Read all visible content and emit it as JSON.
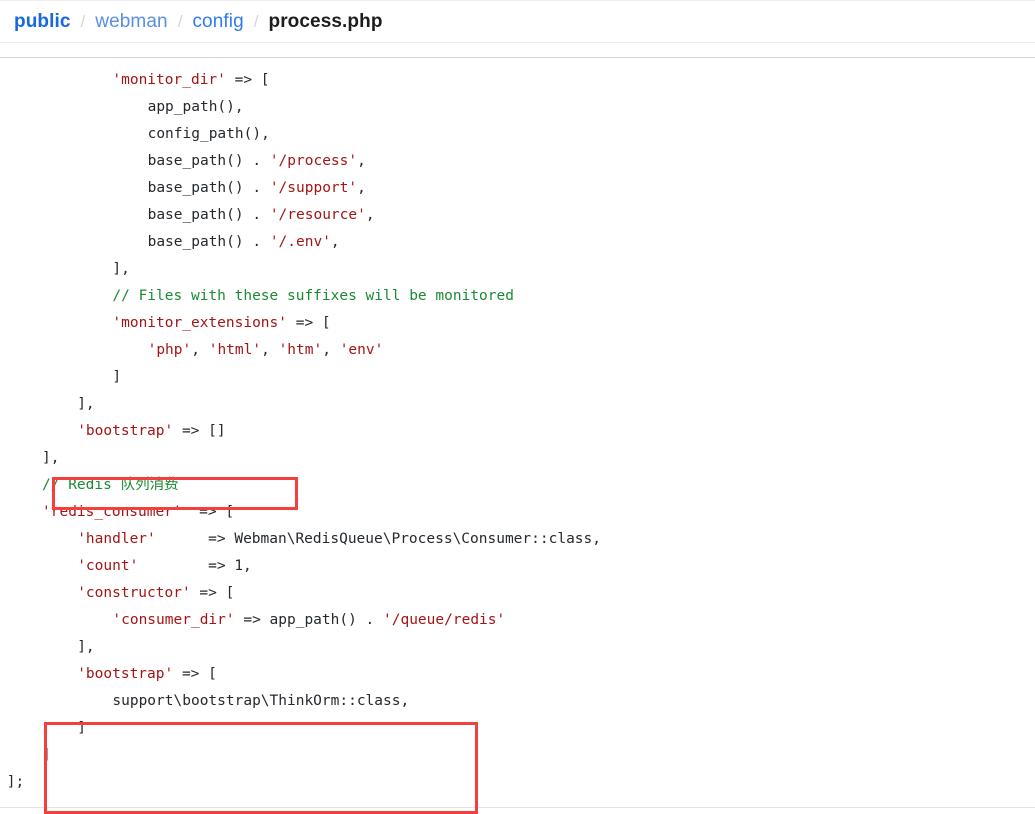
{
  "breadcrumb": {
    "separator": "/",
    "items": [
      {
        "label": "public",
        "kind": "root-link"
      },
      {
        "label": "webman",
        "kind": "link"
      },
      {
        "label": "config",
        "kind": "link"
      },
      {
        "label": "process.php",
        "kind": "current-file"
      }
    ]
  },
  "editor": {
    "language": "php",
    "file_name": "process.php",
    "colors": {
      "string": "#a31515",
      "comment": "#1a8a33",
      "plain": "#24292e",
      "annotation": "#f4403c",
      "breadcrumb_link": "#2f7ced",
      "breadcrumb_current": "#1d1d1d"
    },
    "lines": [
      {
        "indent": 8,
        "parts": [
          {
            "t": "str",
            "v": "'monitor_dir'"
          },
          {
            "t": "pla",
            "v": " => ["
          }
        ]
      },
      {
        "indent": 12,
        "parts": [
          {
            "t": "pla",
            "v": "app_path(),"
          }
        ]
      },
      {
        "indent": 12,
        "parts": [
          {
            "t": "pla",
            "v": "config_path(),"
          }
        ]
      },
      {
        "indent": 12,
        "parts": [
          {
            "t": "pla",
            "v": "base_path() . "
          },
          {
            "t": "str",
            "v": "'/process'"
          },
          {
            "t": "pla",
            "v": ","
          }
        ]
      },
      {
        "indent": 12,
        "parts": [
          {
            "t": "pla",
            "v": "base_path() . "
          },
          {
            "t": "str",
            "v": "'/support'"
          },
          {
            "t": "pla",
            "v": ","
          }
        ]
      },
      {
        "indent": 12,
        "parts": [
          {
            "t": "pla",
            "v": "base_path() . "
          },
          {
            "t": "str",
            "v": "'/resource'"
          },
          {
            "t": "pla",
            "v": ","
          }
        ]
      },
      {
        "indent": 12,
        "parts": [
          {
            "t": "pla",
            "v": "base_path() . "
          },
          {
            "t": "str",
            "v": "'/.env'"
          },
          {
            "t": "pla",
            "v": ","
          }
        ]
      },
      {
        "indent": 8,
        "parts": [
          {
            "t": "pla",
            "v": "],"
          }
        ]
      },
      {
        "indent": 8,
        "parts": [
          {
            "t": "cmt",
            "v": "// Files with these suffixes will be monitored"
          }
        ]
      },
      {
        "indent": 8,
        "parts": [
          {
            "t": "str",
            "v": "'monitor_extensions'"
          },
          {
            "t": "pla",
            "v": " => ["
          }
        ]
      },
      {
        "indent": 12,
        "parts": [
          {
            "t": "str",
            "v": "'php'"
          },
          {
            "t": "pla",
            "v": ", "
          },
          {
            "t": "str",
            "v": "'html'"
          },
          {
            "t": "pla",
            "v": ", "
          },
          {
            "t": "str",
            "v": "'htm'"
          },
          {
            "t": "pla",
            "v": ", "
          },
          {
            "t": "str",
            "v": "'env'"
          }
        ]
      },
      {
        "indent": 8,
        "parts": [
          {
            "t": "pla",
            "v": "]"
          }
        ]
      },
      {
        "indent": 4,
        "parts": [
          {
            "t": "pla",
            "v": "],"
          }
        ]
      },
      {
        "indent": 4,
        "parts": [
          {
            "t": "str",
            "v": "'bootstrap'"
          },
          {
            "t": "pla",
            "v": " => []"
          }
        ]
      },
      {
        "indent": 0,
        "parts": [
          {
            "t": "pla",
            "v": "],"
          }
        ]
      },
      {
        "indent": 0,
        "parts": [
          {
            "t": "cmt",
            "v": "// Redis 队列消费"
          }
        ]
      },
      {
        "indent": 0,
        "parts": [
          {
            "t": "str",
            "v": "'redis_consumer'"
          },
          {
            "t": "pla",
            "v": "  => ["
          }
        ]
      },
      {
        "indent": 4,
        "parts": [
          {
            "t": "str",
            "v": "'handler'"
          },
          {
            "t": "pla",
            "v": "      => Webman\\RedisQueue\\Process\\Consumer::class,"
          }
        ]
      },
      {
        "indent": 4,
        "parts": [
          {
            "t": "str",
            "v": "'count'"
          },
          {
            "t": "pla",
            "v": "        => 1,"
          }
        ]
      },
      {
        "indent": 4,
        "parts": [
          {
            "t": "str",
            "v": "'constructor'"
          },
          {
            "t": "pla",
            "v": " => ["
          }
        ]
      },
      {
        "indent": 8,
        "parts": [
          {
            "t": "str",
            "v": "'consumer_dir'"
          },
          {
            "t": "pla",
            "v": " => app_path() . "
          },
          {
            "t": "str",
            "v": "'/queue/redis'"
          }
        ]
      },
      {
        "indent": 4,
        "parts": [
          {
            "t": "pla",
            "v": "],"
          }
        ]
      },
      {
        "indent": 4,
        "parts": [
          {
            "t": "str",
            "v": "'bootstrap'"
          },
          {
            "t": "pla",
            "v": " => ["
          }
        ]
      },
      {
        "indent": 8,
        "parts": [
          {
            "t": "pla",
            "v": "support\\bootstrap\\ThinkOrm::class,"
          }
        ]
      },
      {
        "indent": 4,
        "parts": [
          {
            "t": "pla",
            "v": "]"
          }
        ]
      },
      {
        "indent": 0,
        "parts": [
          {
            "t": "pla",
            "v": "]"
          }
        ]
      },
      {
        "indent": -4,
        "parts": [
          {
            "t": "pla",
            "v": "];"
          }
        ]
      }
    ]
  },
  "annotations": [
    {
      "id": "redbox-1",
      "target_text": "'bootstrap' => []",
      "shape": "rectangle",
      "color": "#f4403c"
    },
    {
      "id": "redbox-2",
      "target_text": "'bootstrap' => [ support\\bootstrap\\ThinkOrm::class, ]",
      "shape": "rectangle",
      "color": "#f4403c"
    }
  ]
}
